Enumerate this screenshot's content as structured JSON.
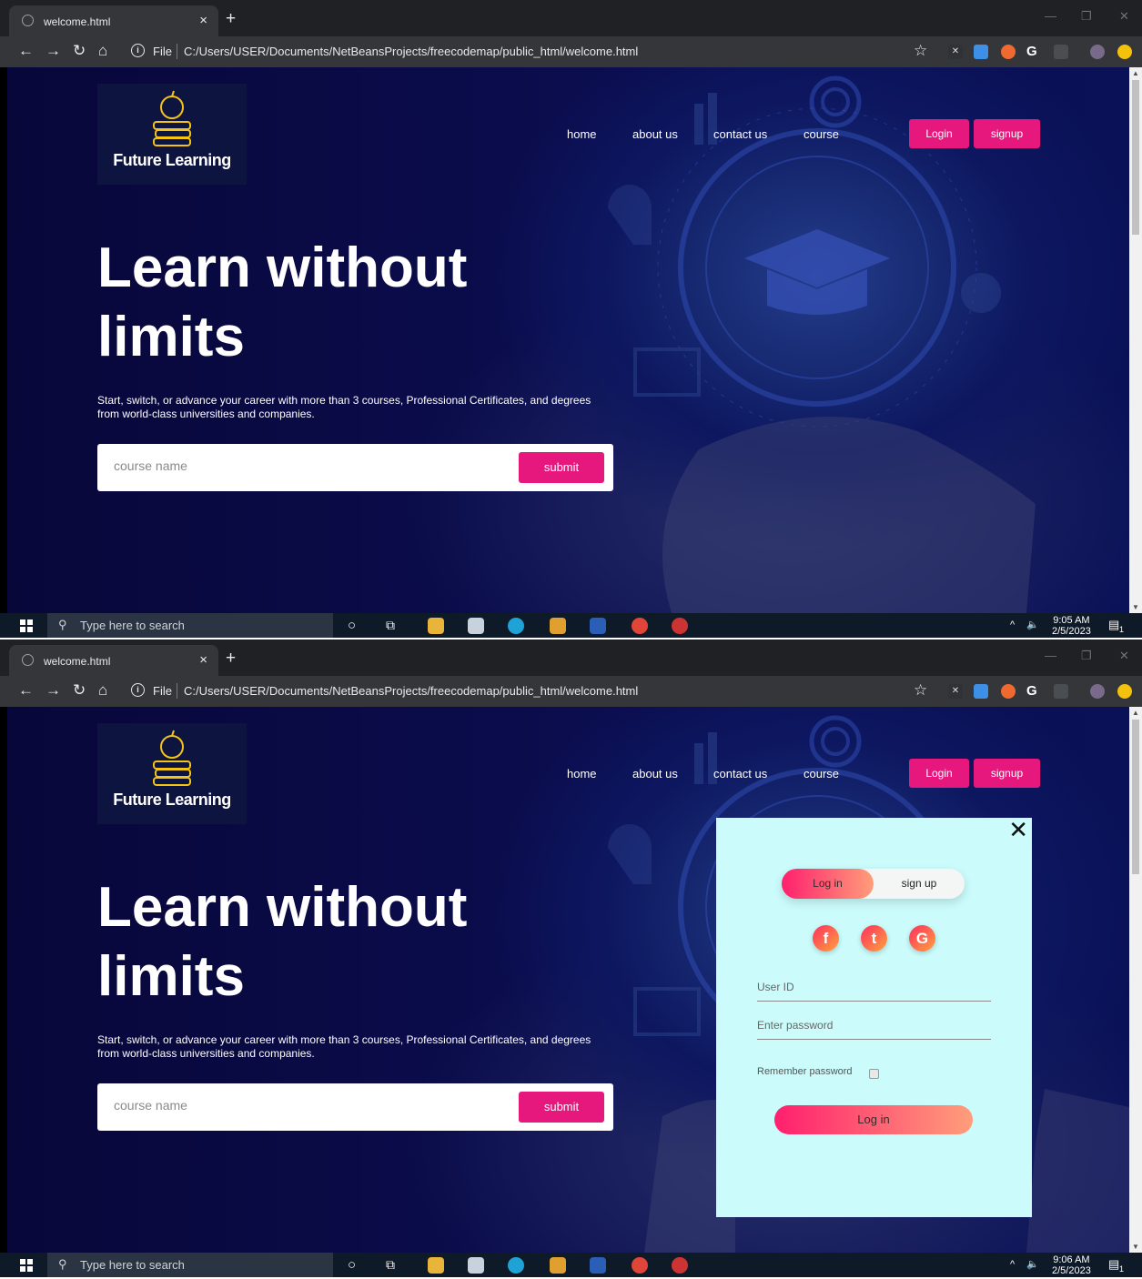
{
  "browser": {
    "tab_title": "welcome.html",
    "tab_close": "×",
    "new_tab": "+",
    "file_label": "File",
    "url": "C:/Users/USER/Documents/NetBeansProjects/freecodemap/public_html/welcome.html"
  },
  "site": {
    "logo_text": "Future Learning",
    "nav": [
      "home",
      "about us",
      "contact us",
      "course"
    ],
    "login_button": "Login",
    "signup_button": "signup",
    "hero_title_line1": "Learn without",
    "hero_title_line2": "limits",
    "subtitle": "Start, switch, or advance your career with more than 3 courses, Professional Certificates, and degrees from world-class universities and companies.",
    "search_placeholder": "course name",
    "submit_label": "submit"
  },
  "modal": {
    "close": "✕",
    "tab_login": "Log in",
    "tab_signup": "sign up",
    "social": [
      "f",
      "t",
      "G"
    ],
    "user_id_placeholder": "User ID",
    "password_placeholder": "Enter password",
    "remember_label": "Remember password",
    "login_button": "Log in"
  },
  "taskbar": {
    "search_placeholder": "Type here to search",
    "shot1_time": "9:05 AM",
    "shot1_date": "2/5/2023",
    "shot2_time": "9:06 AM",
    "shot2_date": "2/5/2023",
    "notification_count": "1"
  },
  "colors": {
    "accent_pink": "#e6177d",
    "page_bg": "#0b0d4e",
    "modal_bg": "#cbfbfb"
  }
}
